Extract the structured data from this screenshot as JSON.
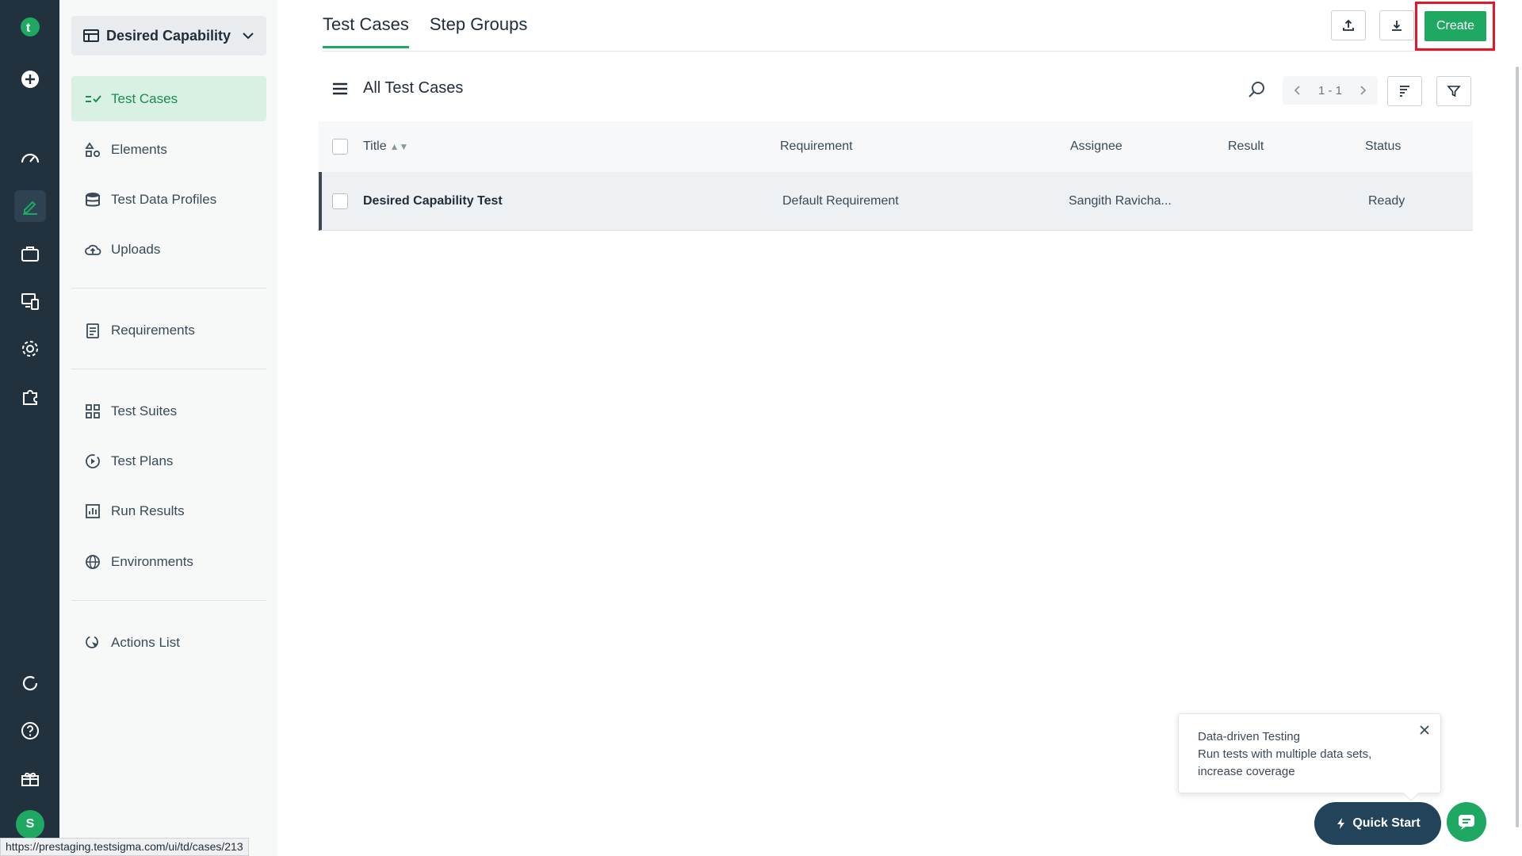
{
  "rail": {
    "items": [
      "add-icon",
      "dashboard-icon",
      "edit-icon",
      "briefcase-icon",
      "devices-icon",
      "settings-icon",
      "plugin-icon",
      "refresh-icon",
      "help-icon",
      "gift-icon"
    ],
    "avatar_initial": "S"
  },
  "sidebar": {
    "project": "Desired Capability",
    "items": [
      {
        "label": "Test Cases",
        "icon": "test-cases-icon",
        "active": true
      },
      {
        "label": "Elements",
        "icon": "elements-icon"
      },
      {
        "label": "Test Data Profiles",
        "icon": "database-icon"
      },
      {
        "label": "Uploads",
        "icon": "cloud-upload-icon"
      },
      {
        "label": "Requirements",
        "icon": "clipboard-icon"
      },
      {
        "label": "Test Suites",
        "icon": "grid-icon"
      },
      {
        "label": "Test Plans",
        "icon": "play-circle-icon"
      },
      {
        "label": "Run Results",
        "icon": "bar-chart-icon"
      },
      {
        "label": "Environments",
        "icon": "globe-icon"
      },
      {
        "label": "Actions List",
        "icon": "cursor-icon"
      }
    ]
  },
  "tabs": [
    "Test Cases",
    "Step Groups"
  ],
  "toolbar": {
    "create_label": "Create"
  },
  "list": {
    "title": "All Test Cases",
    "pager": "1 - 1",
    "columns": [
      "Title",
      "Requirement",
      "Assignee",
      "Result",
      "Status"
    ],
    "rows": [
      {
        "title": "Desired Capability Test",
        "requirement": "Default Requirement",
        "assignee": "Sangith Ravicha...",
        "result": "",
        "status": "Ready"
      }
    ]
  },
  "tooltip": {
    "title": "Data-driven Testing",
    "line1": "Run tests with multiple data sets,",
    "line2": "increase coverage"
  },
  "quick_start": "Quick Start",
  "statusbar_url": "https://prestaging.testsigma.com/ui/td/cases/213",
  "colors": {
    "accent": "#1ea862",
    "rail": "#22313e",
    "highlight": "#e0192a"
  }
}
